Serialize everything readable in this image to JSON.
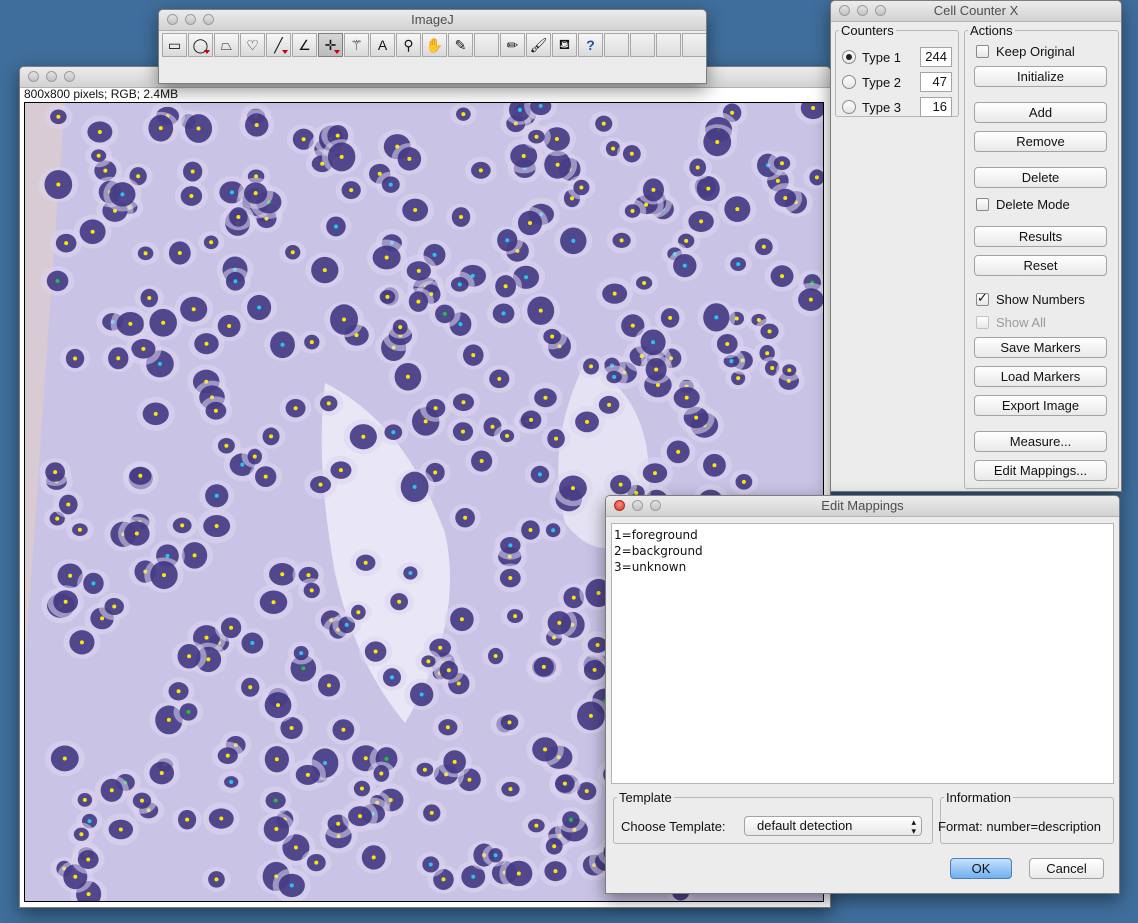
{
  "image_window": {
    "info": "800x800 pixels; RGB; 2.4MB"
  },
  "toolbar": {
    "title": "ImageJ",
    "tools": [
      {
        "name": "rectangle-tool-icon",
        "glyph": "▭",
        "tri": false
      },
      {
        "name": "oval-tool-icon",
        "glyph": "◯",
        "tri": true
      },
      {
        "name": "polygon-tool-icon",
        "glyph": "⏢",
        "tri": false
      },
      {
        "name": "freehand-tool-icon",
        "glyph": "♡",
        "tri": false
      },
      {
        "name": "line-tool-icon",
        "glyph": "╱",
        "tri": true
      },
      {
        "name": "angle-tool-icon",
        "glyph": "∠",
        "tri": false
      },
      {
        "name": "point-tool-icon",
        "glyph": "✛",
        "tri": true,
        "selected": true
      },
      {
        "name": "wand-tool-icon",
        "glyph": "⚚",
        "tri": false
      },
      {
        "name": "text-tool-icon",
        "glyph": "A",
        "tri": false
      },
      {
        "name": "magnifier-tool-icon",
        "glyph": "⚲",
        "tri": false
      },
      {
        "name": "hand-tool-icon",
        "glyph": "✋",
        "tri": false
      },
      {
        "name": "dropper-tool-icon",
        "glyph": "✎",
        "tri": false
      },
      {
        "name": "blank-tool-slot",
        "glyph": "",
        "tri": false,
        "blank": true
      },
      {
        "name": "pencil-tool-icon",
        "glyph": "✏",
        "tri": false
      },
      {
        "name": "brush-tool-icon",
        "glyph": "🖌",
        "tri": false
      },
      {
        "name": "flood-fill-tool-icon",
        "glyph": "⛾",
        "tri": false
      },
      {
        "name": "help-tool-icon",
        "glyph": "?",
        "tri": false
      },
      {
        "name": "blank-tool-slot",
        "glyph": "",
        "tri": false,
        "blank": true
      },
      {
        "name": "blank-tool-slot",
        "glyph": "",
        "tri": false,
        "blank": true
      },
      {
        "name": "blank-tool-slot",
        "glyph": "",
        "tri": false,
        "blank": true
      },
      {
        "name": "blank-tool-slot",
        "glyph": "",
        "tri": false,
        "blank": true
      },
      {
        "name": "more-tools-icon",
        "glyph": "»",
        "tri": false
      }
    ]
  },
  "cell_counter": {
    "title": "Cell Counter X",
    "counters_label": "Counters",
    "actions_label": "Actions",
    "types": [
      {
        "label": "Type 1",
        "count": "244",
        "selected": true
      },
      {
        "label": "Type 2",
        "count": "47",
        "selected": false
      },
      {
        "label": "Type 3",
        "count": "16",
        "selected": false
      }
    ],
    "keep_original": "Keep Original",
    "initialize": "Initialize",
    "add": "Add",
    "remove": "Remove",
    "delete": "Delete",
    "delete_mode": "Delete Mode",
    "results": "Results",
    "reset": "Reset",
    "show_numbers": "Show Numbers",
    "show_all": "Show All",
    "save_markers": "Save Markers",
    "load_markers": "Load Markers",
    "export_image": "Export Image",
    "measure": "Measure...",
    "edit_mappings": "Edit Mappings..."
  },
  "edit_mappings": {
    "title": "Edit Mappings",
    "lines": [
      "1=foreground",
      "2=background",
      "3=unknown"
    ],
    "template_label": "Template",
    "choose_template": "Choose Template:",
    "template_value": "default detection",
    "information_label": "Information",
    "information_text": "Format: number=description",
    "ok": "OK",
    "cancel": "Cancel"
  },
  "colors": {
    "desktop": "#3f6e9c",
    "tissue": "#c9c3e6",
    "nucleus": "#3a2f7d",
    "marker_type1": "#ffe600",
    "marker_type2": "#25c6f0",
    "marker_type3": "#20c040"
  }
}
